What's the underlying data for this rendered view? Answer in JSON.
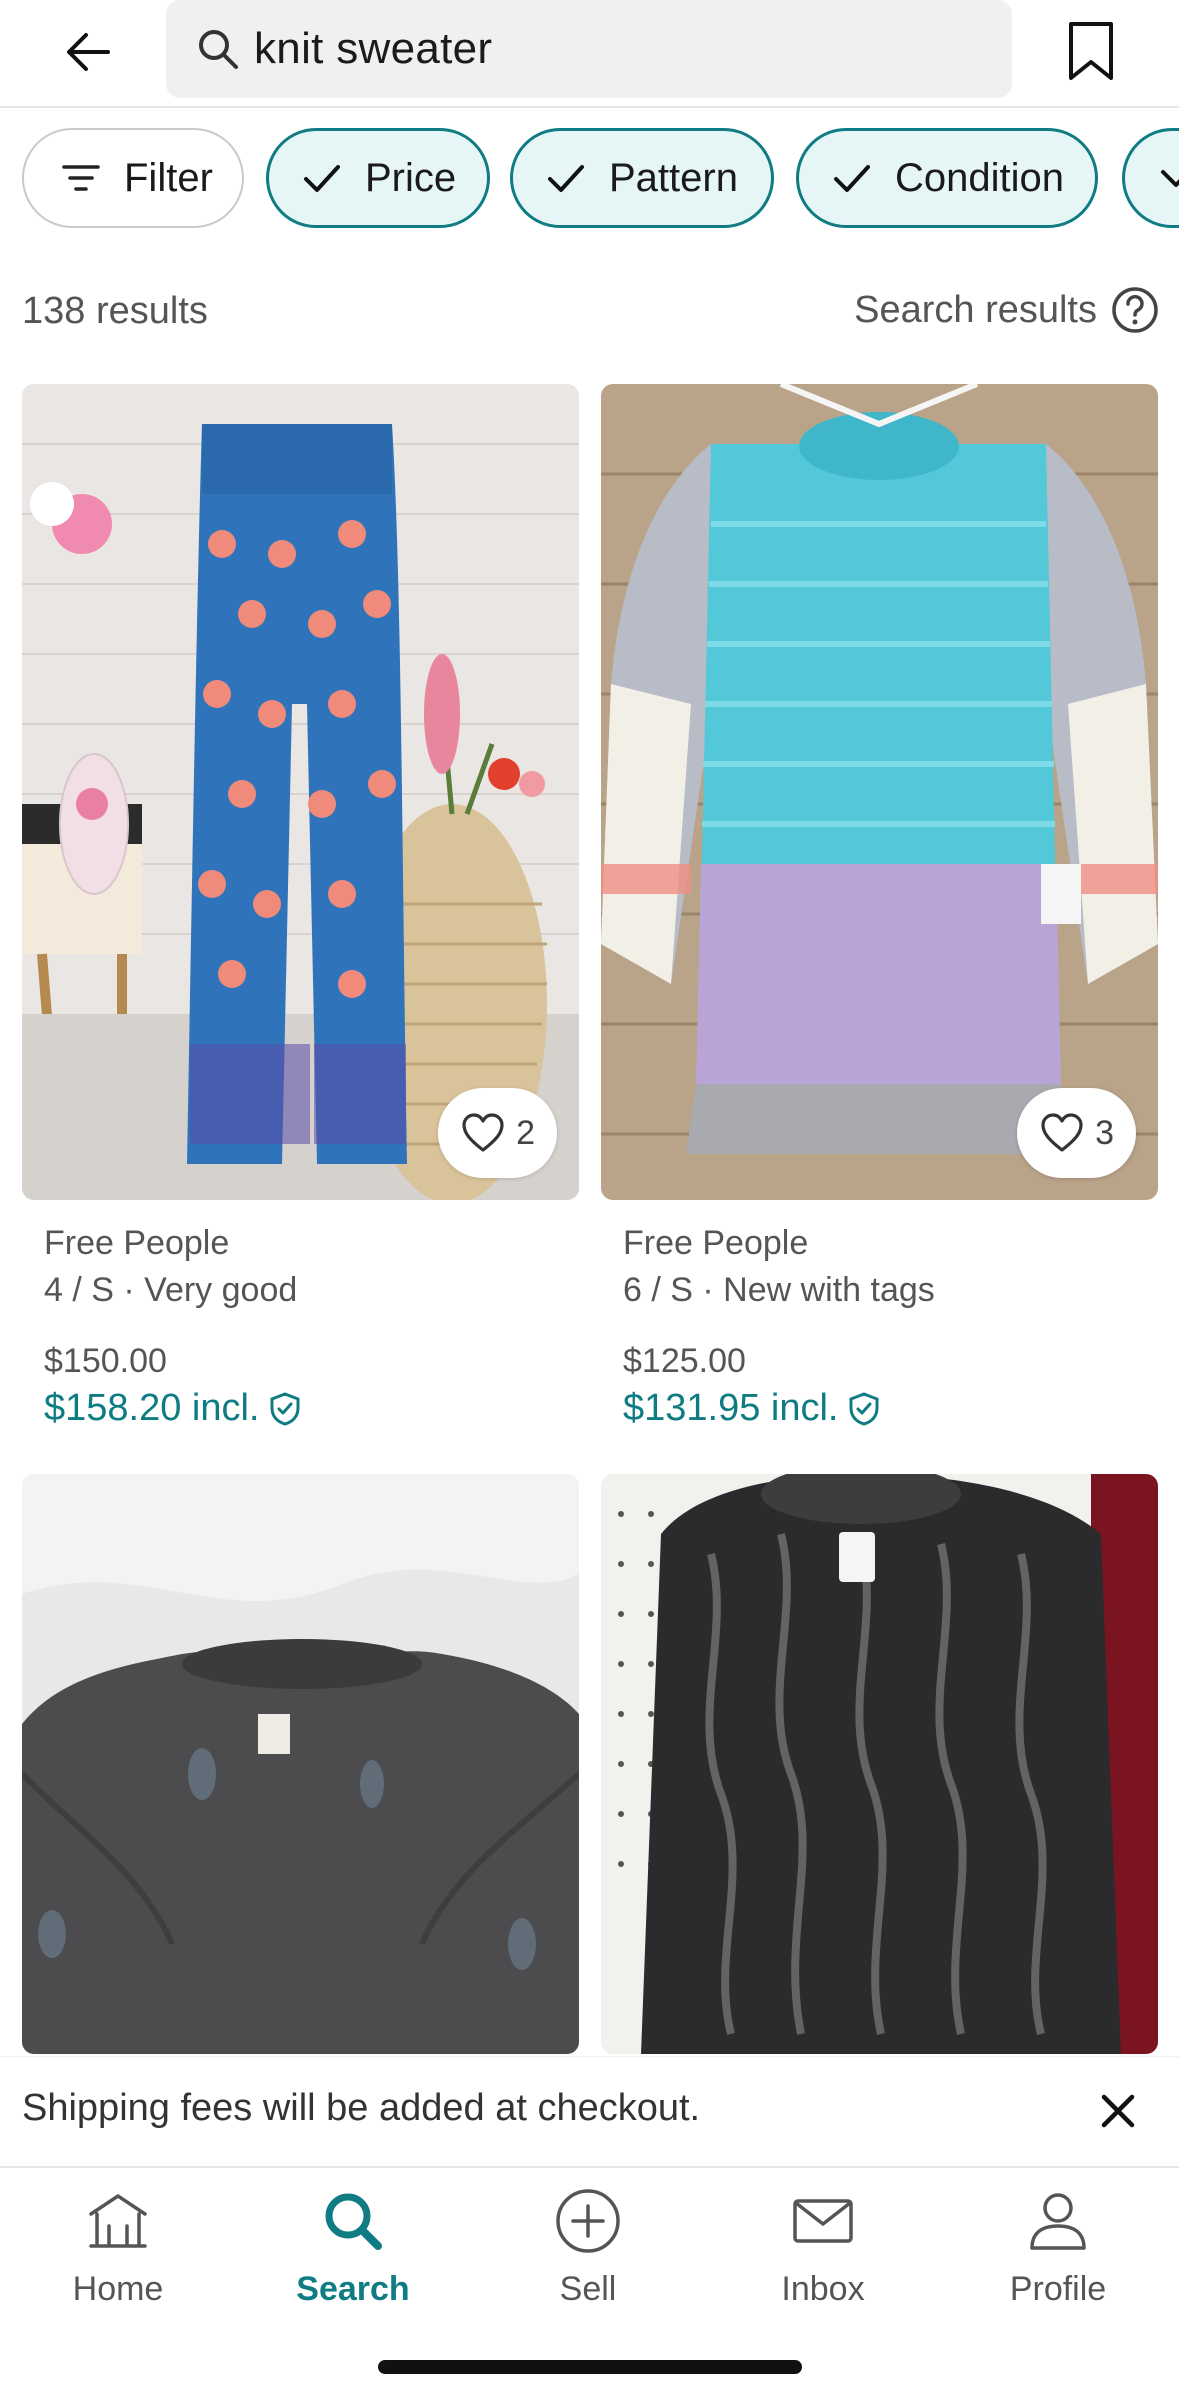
{
  "header": {
    "search_query": "knit sweater"
  },
  "chips": [
    {
      "label": "Filter",
      "icon": "filter-lines-icon",
      "active": false
    },
    {
      "label": "Price",
      "icon": "check-icon",
      "active": true
    },
    {
      "label": "Pattern",
      "icon": "check-icon",
      "active": true
    },
    {
      "label": "Condition",
      "icon": "check-icon",
      "active": true
    }
  ],
  "results": {
    "count_label": "138 results",
    "help_label": "Search results"
  },
  "listings": [
    {
      "brand": "Free People",
      "details": "4 / S · Very good",
      "price": "$150.00",
      "price_incl": "$158.20 incl.",
      "likes": "2",
      "image": "blue-floral-knit-pants"
    },
    {
      "brand": "Free People",
      "details": "6 / S · New with tags",
      "price": "$125.00",
      "price_incl": "$131.95 incl.",
      "likes": "3",
      "image": "aqua-lavender-striped-sweater"
    },
    {
      "image": "charcoal-knit-top"
    },
    {
      "image": "black-cable-knit-sweater"
    }
  ],
  "banner": {
    "shipping_text": "Shipping fees will be added at checkout."
  },
  "nav": [
    {
      "label": "Home",
      "icon": "bank-home-icon",
      "active": false
    },
    {
      "label": "Search",
      "icon": "search-icon",
      "active": true
    },
    {
      "label": "Sell",
      "icon": "plus-circle-icon",
      "active": false
    },
    {
      "label": "Inbox",
      "icon": "mail-icon",
      "active": false
    },
    {
      "label": "Profile",
      "icon": "person-icon",
      "active": false
    }
  ],
  "colors": {
    "accent": "#0f7c83",
    "chip_active_bg": "#e6f6f7",
    "search_bg": "#eef0f1"
  }
}
